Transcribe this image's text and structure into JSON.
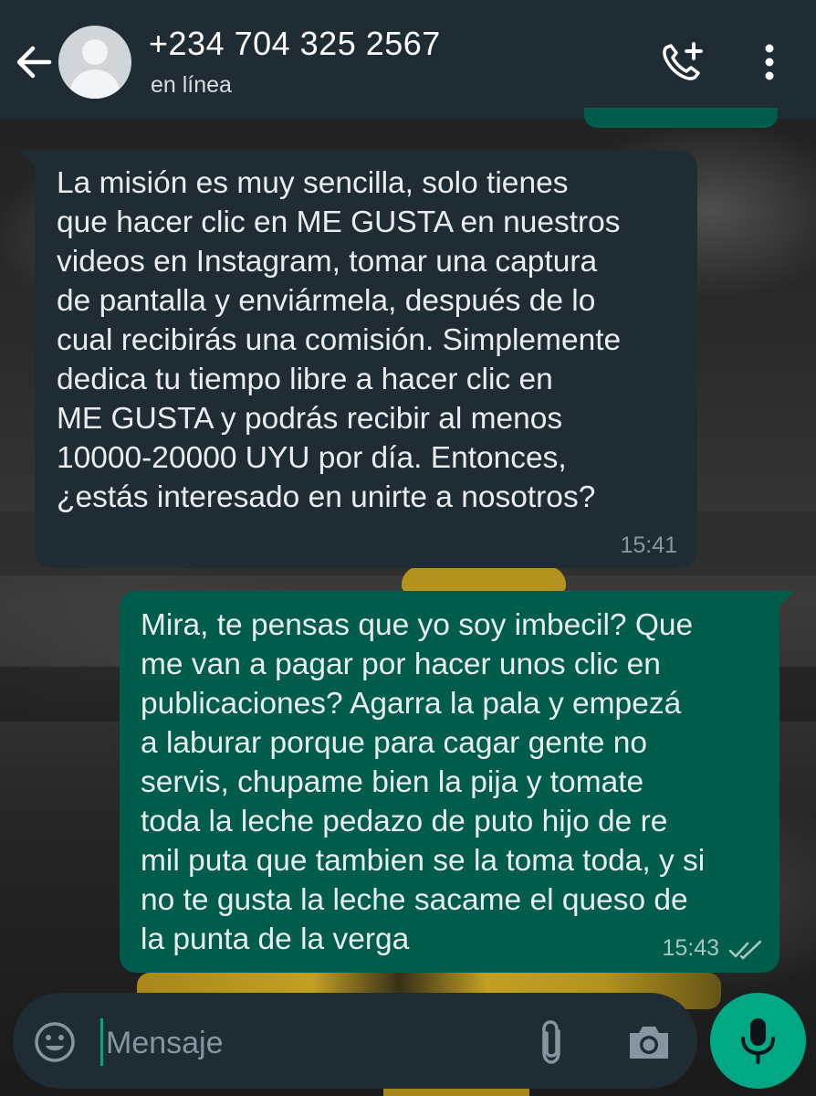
{
  "header": {
    "contact_name": "+234 704 325 2567",
    "status": "en línea",
    "icons": [
      "back-arrow-icon",
      "avatar",
      "add-call-icon",
      "more-options-icon"
    ]
  },
  "messages": [
    {
      "direction": "incoming",
      "text": "La misión es muy sencilla, solo tienes\nque hacer clic en ME GUSTA en nuestros\nvideos en Instagram, tomar una captura\nde pantalla y enviármela, después de lo\ncual recibirás una comisión. Simplemente\ndedica tu tiempo libre a hacer clic en\nME GUSTA y podrás recibir al menos\n10000-20000 UYU por día. Entonces,\n¿estás interesado en unirte a nosotros?",
      "time": "15:41"
    },
    {
      "direction": "outgoing",
      "text": "Mira, te pensas que yo soy imbecil? Que\nme van a pagar por hacer unos clic en\npublicaciones? Agarra la pala y empezá\na laburar porque para cagar gente no\nservis, chupame bien la pija y tomate\ntoda la leche pedazo de puto hijo de re\nmil puta que tambien se la toma toda, y si\nno te gusta la leche sacame el queso de\nla punta de la verga",
      "time": "15:43",
      "status": "read"
    }
  ],
  "composer": {
    "placeholder": "Mensaje",
    "icons": [
      "emoji-icon",
      "attach-icon",
      "camera-icon",
      "microphone-icon"
    ]
  },
  "colors": {
    "header_bg": "#1f2c34",
    "incoming_bubble": "#1f2c34",
    "outgoing_bubble": "#005c4b",
    "accent": "#00a884",
    "text": "#e9edef",
    "meta_text": "#8696a0"
  }
}
